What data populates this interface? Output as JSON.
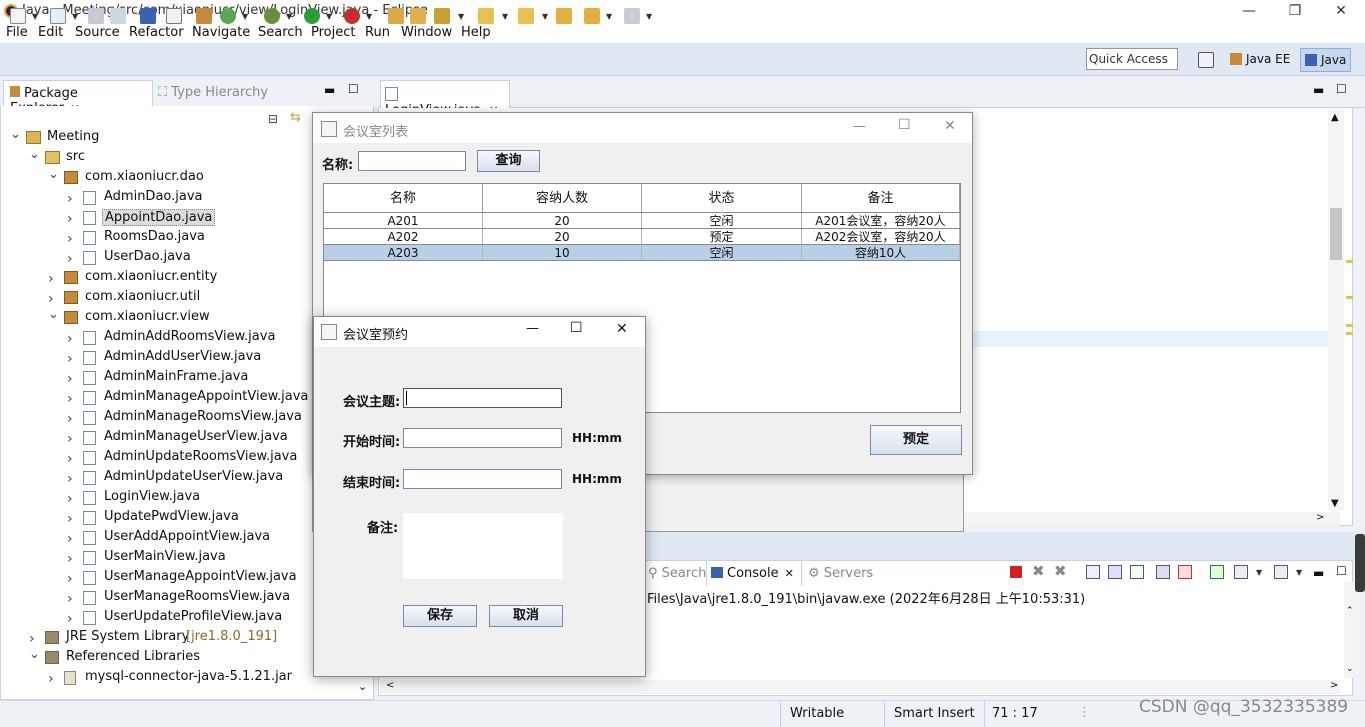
{
  "window": {
    "title": "Java - Meeting/src/com/xiaoniucr/view/LoginView.java - Eclipse",
    "min": "—",
    "max": "❐",
    "close": "✕"
  },
  "menu": [
    "File",
    "Edit",
    "Source",
    "Refactor",
    "Navigate",
    "Search",
    "Project",
    "Run",
    "Window",
    "Help"
  ],
  "quick_access": "Quick Access",
  "perspectives": [
    "Java EE",
    "Java"
  ],
  "explorer": {
    "tab": "Package Explorer",
    "tab2": "Type Hierarchy",
    "tree": [
      {
        "label": "Meeting",
        "depth": 0,
        "icon": "project-icon",
        "open": true
      },
      {
        "label": "src",
        "depth": 1,
        "icon": "source-folder-icon",
        "open": true
      },
      {
        "label": "com.xiaoniucr.dao",
        "depth": 2,
        "icon": "package-icon",
        "open": true
      },
      {
        "label": "AdminDao.java",
        "depth": 3,
        "icon": "java-file-icon"
      },
      {
        "label": "AppointDao.java",
        "depth": 3,
        "icon": "java-file-icon",
        "selected": true
      },
      {
        "label": "RoomsDao.java",
        "depth": 3,
        "icon": "java-file-icon"
      },
      {
        "label": "UserDao.java",
        "depth": 3,
        "icon": "java-file-icon"
      },
      {
        "label": "com.xiaoniucr.entity",
        "depth": 2,
        "icon": "package-icon"
      },
      {
        "label": "com.xiaoniucr.util",
        "depth": 2,
        "icon": "package-icon"
      },
      {
        "label": "com.xiaoniucr.view",
        "depth": 2,
        "icon": "package-icon",
        "open": true
      },
      {
        "label": "AdminAddRoomsView.java",
        "depth": 3,
        "icon": "java-file-icon"
      },
      {
        "label": "AdminAddUserView.java",
        "depth": 3,
        "icon": "java-file-icon"
      },
      {
        "label": "AdminMainFrame.java",
        "depth": 3,
        "icon": "java-file-icon"
      },
      {
        "label": "AdminManageAppointView.java",
        "depth": 3,
        "icon": "java-file-icon"
      },
      {
        "label": "AdminManageRoomsView.java",
        "depth": 3,
        "icon": "java-file-icon"
      },
      {
        "label": "AdminManageUserView.java",
        "depth": 3,
        "icon": "java-file-icon"
      },
      {
        "label": "AdminUpdateRoomsView.java",
        "depth": 3,
        "icon": "java-file-icon"
      },
      {
        "label": "AdminUpdateUserView.java",
        "depth": 3,
        "icon": "java-file-icon"
      },
      {
        "label": "LoginView.java",
        "depth": 3,
        "icon": "java-file-icon"
      },
      {
        "label": "UpdatePwdView.java",
        "depth": 3,
        "icon": "java-file-icon"
      },
      {
        "label": "UserAddAppointView.java",
        "depth": 3,
        "icon": "java-file-icon"
      },
      {
        "label": "UserMainView.java",
        "depth": 3,
        "icon": "java-file-icon"
      },
      {
        "label": "UserManageAppointView.java",
        "depth": 3,
        "icon": "java-file-icon"
      },
      {
        "label": "UserManageRoomsView.java",
        "depth": 3,
        "icon": "java-file-icon"
      },
      {
        "label": "UserUpdateProfileView.java",
        "depth": 3,
        "icon": "java-file-icon"
      },
      {
        "label": "JRE System Library",
        "extra": "[jre1.8.0_191]",
        "depth": 1,
        "icon": "library-icon"
      },
      {
        "label": "Referenced Libraries",
        "depth": 1,
        "icon": "library-icon",
        "open": true
      },
      {
        "label": "mysql-connector-java-5.1.21.jar",
        "depth": 2,
        "icon": "jar-icon"
      }
    ]
  },
  "editor": {
    "tab": "LoginView.java"
  },
  "console": {
    "tabs": [
      "Search",
      "Console",
      "Servers"
    ],
    "line": "Files\\Java\\jre1.8.0_191\\bin\\javaw.exe (2022年6月28日 上午10:53:31)"
  },
  "status": {
    "writable": "Writable",
    "insert": "Smart Insert",
    "pos": "71 : 17"
  },
  "watermark": "CSDN @qq_3532335389",
  "room_list": {
    "title": "会议室列表",
    "name_label": "名称:",
    "query": "查询",
    "reserve": "预定",
    "headers": [
      "名称",
      "容纳人数",
      "状态",
      "备注"
    ],
    "rows": [
      [
        "A201",
        "20",
        "空闲",
        "A201会议室，容纳20人"
      ],
      [
        "A202",
        "20",
        "预定",
        "A202会议室，容纳20人"
      ],
      [
        "A203",
        "10",
        "空闲",
        "容纳10人"
      ]
    ]
  },
  "reserve_dialog": {
    "title": "会议室预约",
    "topic": "会议主题:",
    "start": "开始时间:",
    "end": "结束时间:",
    "hint": "HH:mm",
    "note": "备注:",
    "save": "保存",
    "cancel": "取消"
  }
}
